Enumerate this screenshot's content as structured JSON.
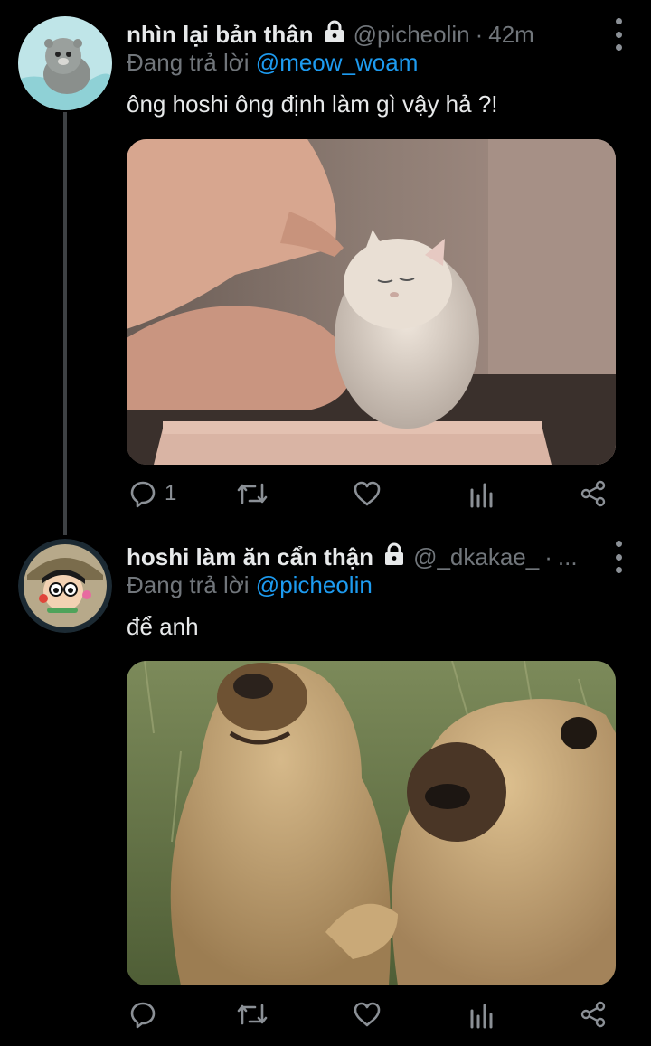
{
  "tweets": [
    {
      "display_name": "nhìn lại bản thân",
      "handle": "@picheolin",
      "separator": "·",
      "time": "42m",
      "replying_prefix": "Đang trả lời",
      "replying_to": "@meow_woam",
      "text": "ông hoshi ông định làm gì vậy hả ?!",
      "media": "cat-photo",
      "reply_count": "1"
    },
    {
      "display_name": "hoshi làm ăn cẩn thận",
      "handle": "@_dkakae_",
      "separator": "·",
      "time": "...",
      "replying_prefix": "Đang trả lời",
      "replying_to": "@picheolin",
      "text": "để anh",
      "media": "marmot-photo",
      "reply_count": ""
    }
  ],
  "colors": {
    "background": "#000000",
    "text": "#e7e9ea",
    "secondary": "#71767b",
    "link": "#1d9bf0",
    "thread_line": "#3e4144"
  },
  "icons": [
    "lock-icon",
    "more-icon",
    "reply-icon",
    "retweet-icon",
    "like-icon",
    "analytics-icon",
    "share-icon"
  ]
}
